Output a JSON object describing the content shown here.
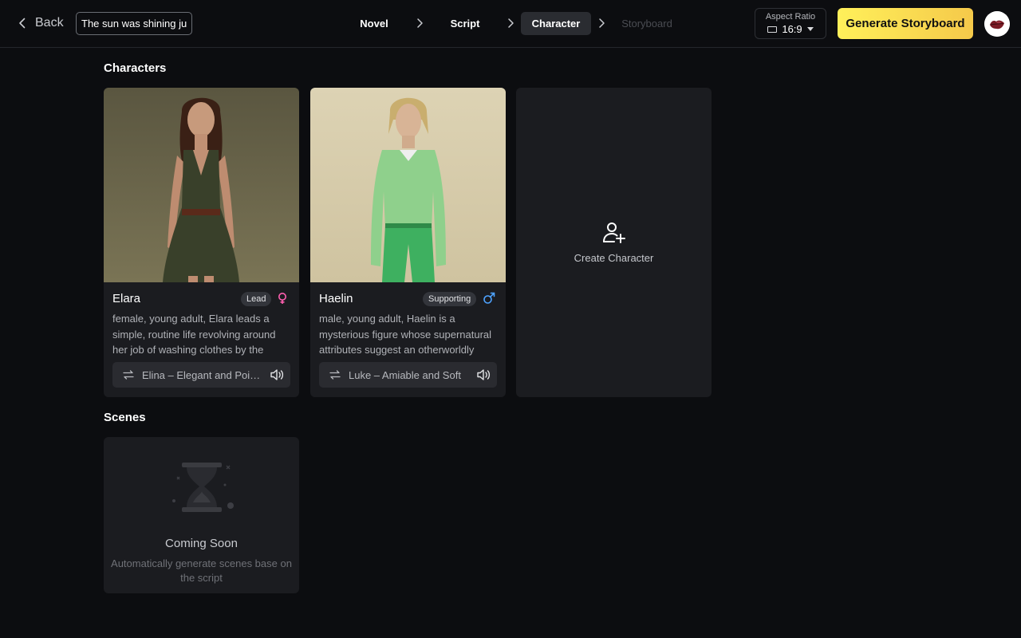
{
  "header": {
    "back_label": "Back",
    "title_value": "The sun was shining just",
    "steps": [
      {
        "label": "Novel"
      },
      {
        "label": "Script"
      },
      {
        "label": "Character"
      },
      {
        "label": "Storyboard"
      }
    ],
    "active_step": "Character",
    "aspect_ratio": {
      "label": "Aspect Ratio",
      "value": "16:9"
    },
    "generate_label": "Generate Storyboard",
    "accent_color": "#fbe257"
  },
  "characters_section": {
    "title": "Characters",
    "characters": [
      {
        "name": "Elara",
        "role": "Lead",
        "gender": "female",
        "gender_icon": "female-icon",
        "gender_color": "#ff5fb0",
        "description": "female, young adult, Elara leads a simple, routine life revolving around her job of washing clothes by the",
        "voice": "Elina – Elegant and Poised"
      },
      {
        "name": "Haelin",
        "role": "Supporting",
        "gender": "male",
        "gender_icon": "male-icon",
        "gender_color": "#4ea3ff",
        "description": "male, young adult, Haelin is a mysterious figure whose supernatural attributes suggest an otherworldly",
        "voice": "Luke – Amiable and Soft"
      }
    ],
    "create_label": "Create Character"
  },
  "scenes_section": {
    "title": "Scenes",
    "coming_soon": "Coming Soon",
    "subtitle": "Automatically generate scenes base on the script"
  }
}
